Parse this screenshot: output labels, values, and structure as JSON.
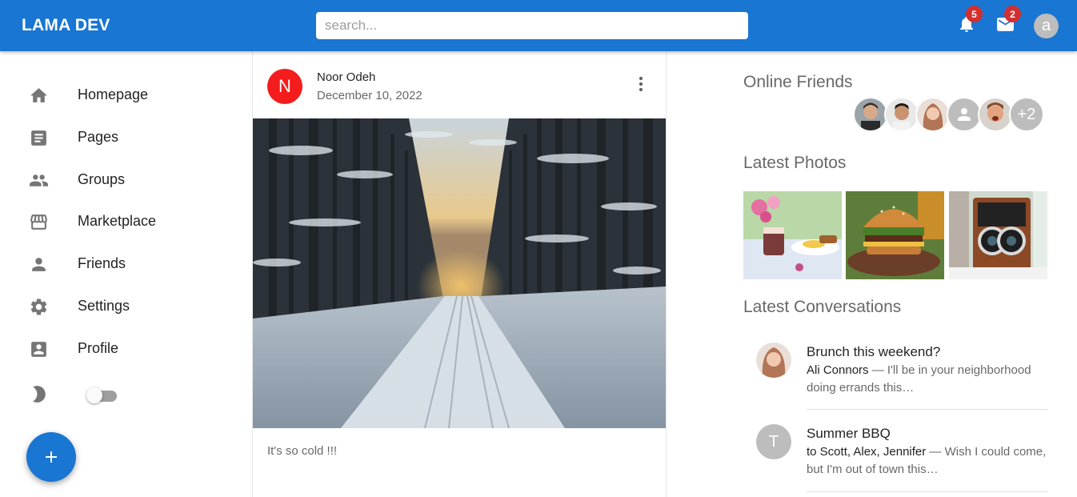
{
  "header": {
    "logo": "LAMA DEV",
    "search_placeholder": "search...",
    "notifications_count": "5",
    "messages_count": "2",
    "avatar_letter": "a"
  },
  "sidebar": {
    "items": [
      {
        "label": "Homepage",
        "icon": "home-icon"
      },
      {
        "label": "Pages",
        "icon": "article-icon"
      },
      {
        "label": "Groups",
        "icon": "group-icon"
      },
      {
        "label": "Marketplace",
        "icon": "storefront-icon"
      },
      {
        "label": "Friends",
        "icon": "person-icon"
      },
      {
        "label": "Settings",
        "icon": "gear-icon"
      },
      {
        "label": "Profile",
        "icon": "account-box-icon"
      }
    ],
    "dark_mode_toggle": false,
    "fab_icon": "plus-icon"
  },
  "post": {
    "avatar_letter": "N",
    "author": "Noor Odeh",
    "date": "December 10, 2022",
    "text": "It's so cold !!!",
    "image": "snowy forest road"
  },
  "rightbar": {
    "online_title": "Online Friends",
    "friends_extra": "+2",
    "photos_title": "Latest Photos",
    "photos": [
      "dessert breakfast",
      "burger",
      "vintage camera"
    ],
    "conversations_title": "Latest Conversations",
    "conversations": [
      {
        "title": "Brunch this weekend?",
        "sender": "Ali Connors",
        "preview": " — I'll be in your neighborhood doing errands this…"
      },
      {
        "avatar_letter": "T",
        "title": "Summer BBQ",
        "sender": "to Scott, Alex, Jennifer",
        "preview": " — Wish I could come, but I'm out of town this…"
      }
    ]
  },
  "colors": {
    "primary": "#1976d2",
    "badge": "#d32f2f",
    "post_avatar": "#f41c1c"
  }
}
